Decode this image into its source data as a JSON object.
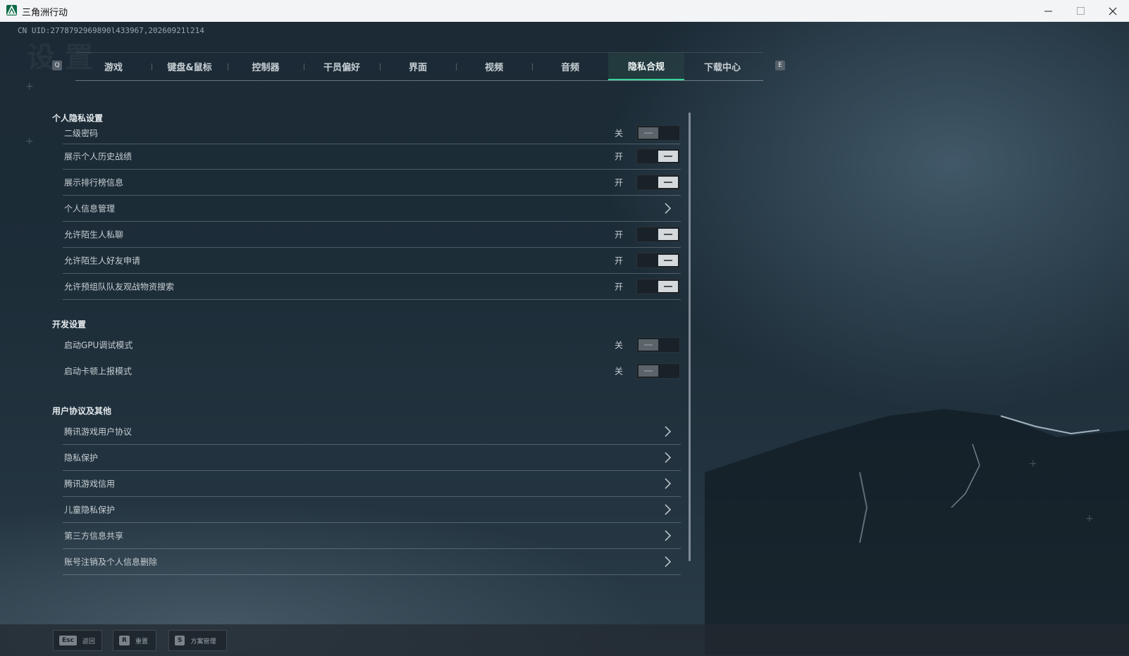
{
  "window": {
    "title": "三角洲行动"
  },
  "uid": "CN UID:2778792969890l433967,20260921l214",
  "background_heading": "设置",
  "tabs": {
    "prev_key": "Q",
    "next_key": "E",
    "items": [
      {
        "label": "游戏"
      },
      {
        "label": "键盘&鼠标"
      },
      {
        "label": "控制器"
      },
      {
        "label": "干员偏好"
      },
      {
        "label": "界面"
      },
      {
        "label": "视频"
      },
      {
        "label": "音频"
      },
      {
        "label": "隐私合规"
      },
      {
        "label": "下载中心"
      }
    ],
    "active": "隐私合规"
  },
  "sections": {
    "privacy": {
      "title": "个人隐私设置",
      "rows": [
        {
          "label": "二级密码",
          "state": "关",
          "on": false
        },
        {
          "label": "展示个人历史战绩",
          "state": "开",
          "on": true
        },
        {
          "label": "展示排行榜信息",
          "state": "开",
          "on": true
        },
        {
          "label": "个人信息管理",
          "link": true
        },
        {
          "label": "允许陌生人私聊",
          "state": "开",
          "on": true
        },
        {
          "label": "允许陌生人好友申请",
          "state": "开",
          "on": true
        },
        {
          "label": "允许预组队队友观战物资搜索",
          "state": "开",
          "on": true
        }
      ]
    },
    "dev": {
      "title": "开发设置",
      "rows": [
        {
          "label": "启动GPU调试模式",
          "state": "关",
          "on": false
        },
        {
          "label": "启动卡顿上报模式",
          "state": "关",
          "on": false
        }
      ]
    },
    "agreements": {
      "title": "用户协议及其他",
      "rows": [
        {
          "label": "腾讯游戏用户协议"
        },
        {
          "label": "隐私保护"
        },
        {
          "label": "腾讯游戏信用"
        },
        {
          "label": "儿童隐私保护"
        },
        {
          "label": "第三方信息共享"
        },
        {
          "label": "账号注销及个人信息删除"
        }
      ]
    }
  },
  "bottom": {
    "buttons": [
      {
        "key": "Esc",
        "label": "返回"
      },
      {
        "key": "R",
        "label": "重置"
      },
      {
        "key": "S",
        "label": "方案管理"
      }
    ]
  },
  "colors": {
    "accent": "#39d39a",
    "toggle_on": "#d5d9dc",
    "toggle_off": "#5b6469"
  },
  "icons": {
    "app": "delta-logo-icon",
    "row_link": "chevron-right-icon"
  }
}
